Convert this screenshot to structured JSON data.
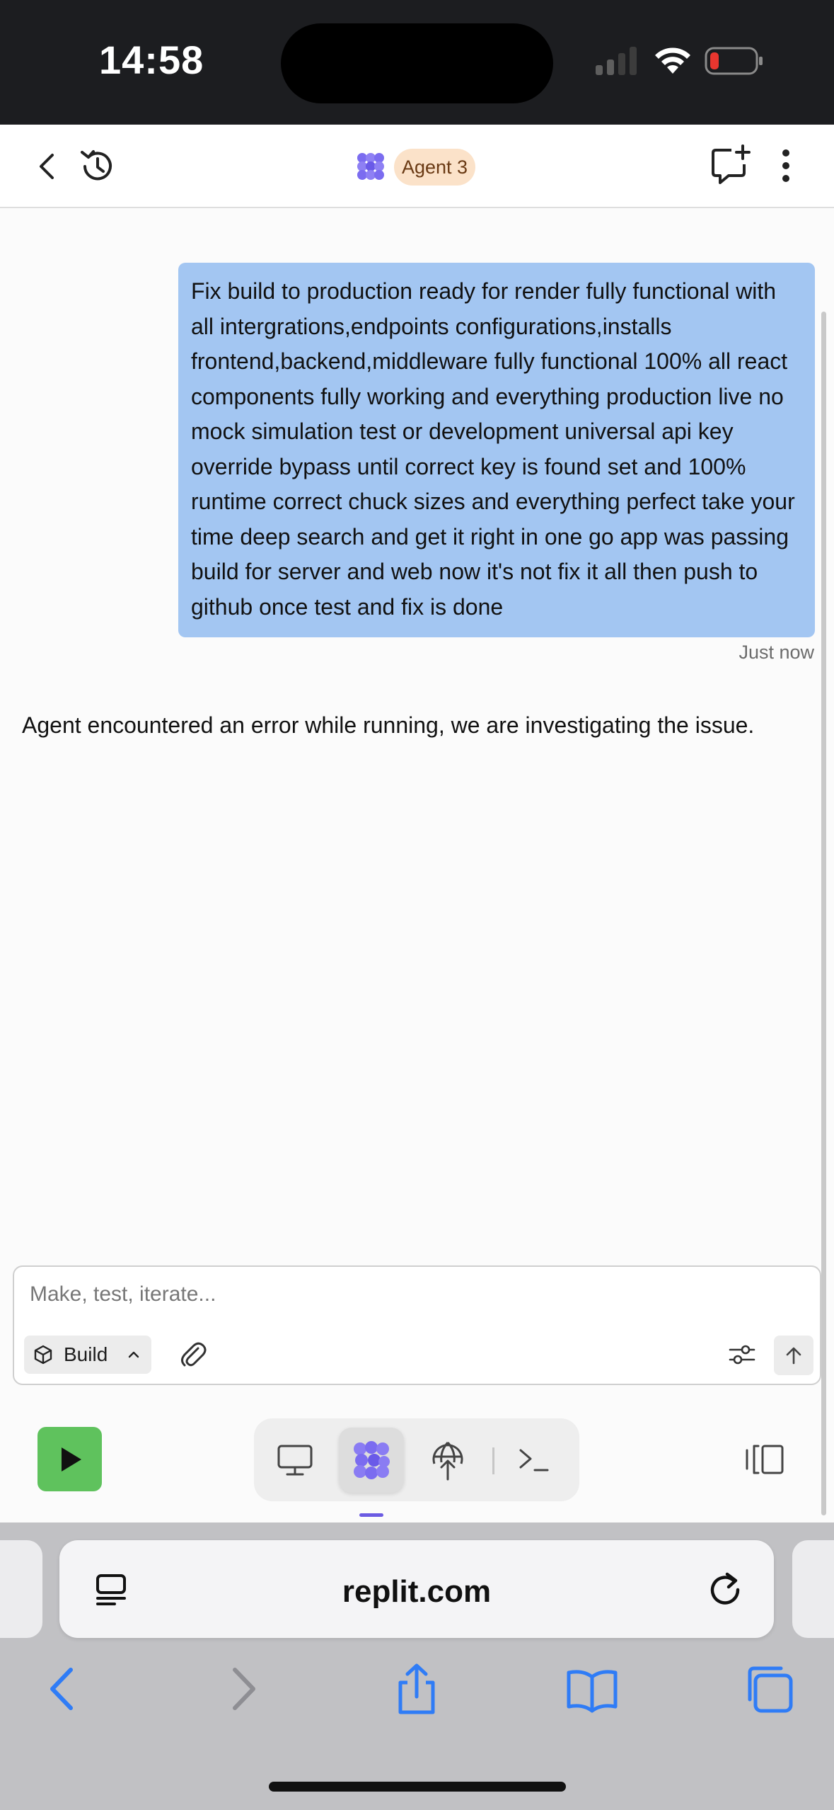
{
  "status_bar": {
    "time": "14:58"
  },
  "header": {
    "agent_label": "Agent 3"
  },
  "chat": {
    "messages": [
      {
        "role": "user",
        "text": "Fix build to production ready for render fully functional with all intergrations,endpoints configurations,installs frontend,backend,middleware fully functional 100% all react components fully working and everything production live no mock simulation test or development universal api key override bypass until correct key is found set and 100% runtime correct chuck sizes and everything perfect take your time deep search and get it right in one go app was passing build for server and web now it's not fix it all then push to github once test and fix is done",
        "timestamp": "Just now"
      },
      {
        "role": "agent",
        "text": "Agent encountered an error while running, we are investigating the issue."
      }
    ]
  },
  "composer": {
    "placeholder": "Make, test, iterate...",
    "mode_label": "Build"
  },
  "toolbar": {
    "tabs": [
      {
        "name": "preview",
        "icon": "monitor-icon"
      },
      {
        "name": "agent",
        "icon": "agent-logo-icon",
        "active": true
      },
      {
        "name": "deployments",
        "icon": "deploy-globe-icon"
      },
      {
        "name": "console",
        "icon": "terminal-icon"
      }
    ]
  },
  "browser": {
    "url": "replit.com"
  },
  "colors": {
    "run_green": "#5fc25d",
    "bubble_blue": "#a3c6f2",
    "agent_purple": "#7b6cf0",
    "safari_blue": "#2f7cf6"
  }
}
